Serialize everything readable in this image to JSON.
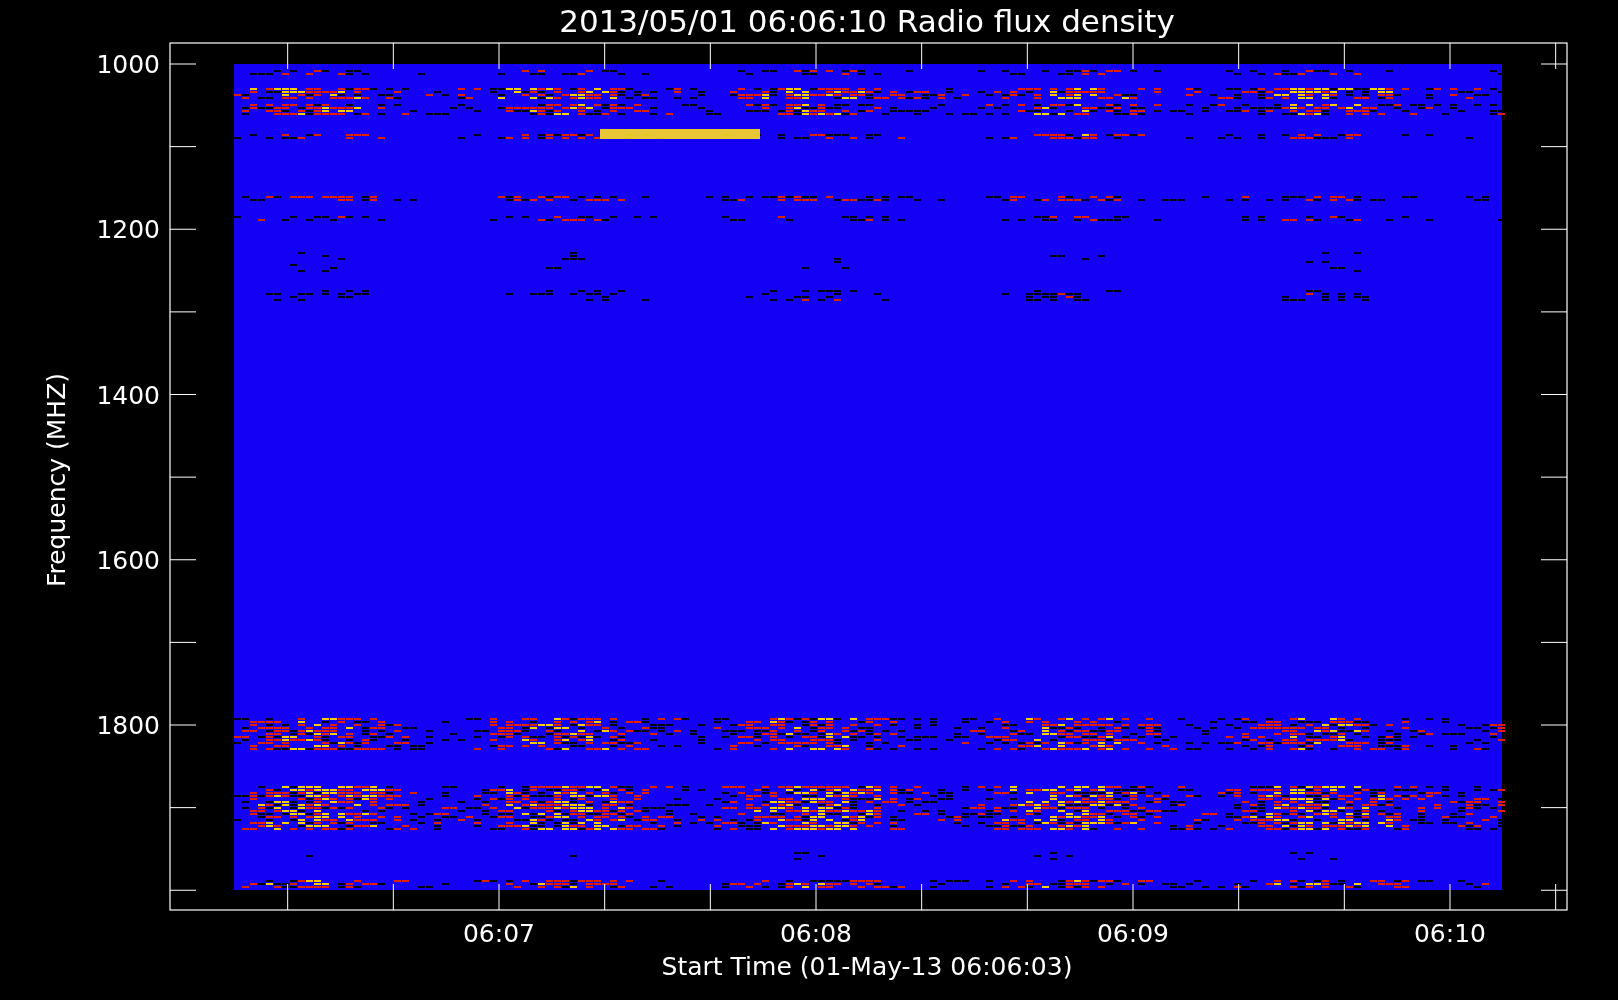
{
  "title": "2013/05/01 06:06:10 Radio flux density",
  "y_axis": {
    "label": "Frequency (MHZ)",
    "ticks": [
      "1000",
      "1200",
      "1400",
      "1600",
      "1800"
    ]
  },
  "x_axis": {
    "label": "Start Time (01-May-13 06:06:03)",
    "ticks": [
      "06:07",
      "06:08",
      "06:09",
      "06:10"
    ]
  }
}
